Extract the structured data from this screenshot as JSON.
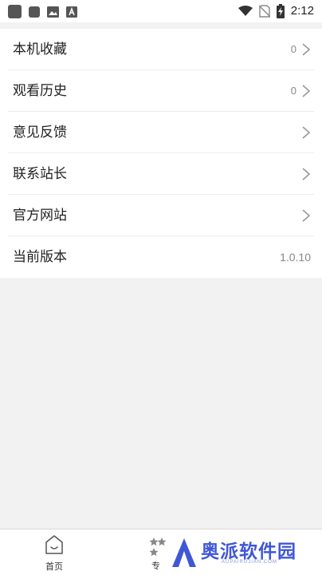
{
  "status_bar": {
    "time": "2:12",
    "icons": [
      "app-square-icon",
      "notification-square-icon",
      "image-icon",
      "text-a-icon",
      "wifi-icon",
      "no-sim-icon",
      "battery-charging-icon"
    ]
  },
  "menu": {
    "items": [
      {
        "label": "本机收藏",
        "value": "0",
        "chevron": true
      },
      {
        "label": "观看历史",
        "value": "0",
        "chevron": true
      },
      {
        "label": "意见反馈",
        "value": "",
        "chevron": true
      },
      {
        "label": "联系站长",
        "value": "",
        "chevron": true
      },
      {
        "label": "官方网站",
        "value": "",
        "chevron": true
      },
      {
        "label": "当前版本",
        "value": "1.0.10",
        "chevron": false
      }
    ]
  },
  "tab_bar": {
    "home_label": "首页",
    "topic_label": "专"
  },
  "watermark": {
    "text": "奥派软件园",
    "subtext": "AUPAIRUJIAN.COM",
    "color": "#3f57d6"
  }
}
